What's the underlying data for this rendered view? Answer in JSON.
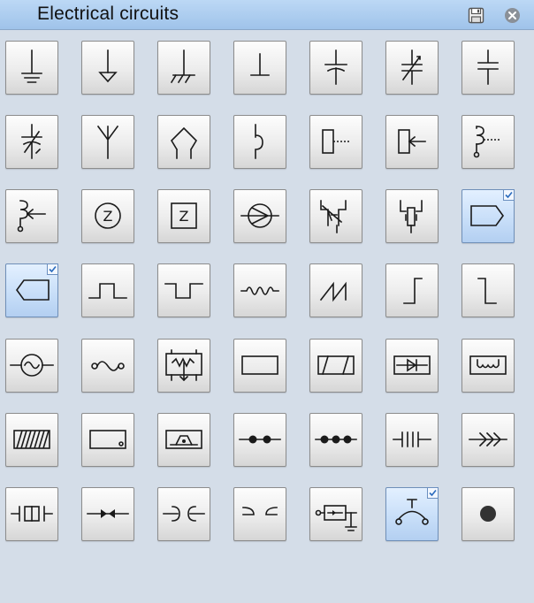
{
  "palette": {
    "title": "Electrical circuits"
  },
  "icons": {
    "save": "save-icon",
    "close": "close-icon",
    "checkmark": "checkmark-icon"
  },
  "colors": {
    "background": "#d4dde8",
    "titlebar": "#a9cbee",
    "selected_tile": "#c6ddf8",
    "symbol": "#1a1a1a"
  },
  "symbols": [
    {
      "name": "ground",
      "selected": false
    },
    {
      "name": "signal-ground",
      "selected": false
    },
    {
      "name": "chassis-ground",
      "selected": false
    },
    {
      "name": "earth-line",
      "selected": false
    },
    {
      "name": "capacitor",
      "selected": false
    },
    {
      "name": "variable-capacitor",
      "selected": false
    },
    {
      "name": "capacitor-vertical",
      "selected": false
    },
    {
      "name": "trimmer-capacitor",
      "selected": false
    },
    {
      "name": "antenna",
      "selected": false
    },
    {
      "name": "dipole-antenna",
      "selected": false
    },
    {
      "name": "jack",
      "selected": false
    },
    {
      "name": "relay-contact",
      "selected": false
    },
    {
      "name": "relay-input",
      "selected": false
    },
    {
      "name": "coil-dotted",
      "selected": false
    },
    {
      "name": "coil-arrow",
      "selected": false
    },
    {
      "name": "impedance-circle",
      "selected": false
    },
    {
      "name": "impedance-box",
      "selected": false
    },
    {
      "name": "current-source",
      "selected": false
    },
    {
      "name": "variable-resistor-switch",
      "selected": false
    },
    {
      "name": "resistor-contact",
      "selected": false
    },
    {
      "name": "output-terminal",
      "selected": true
    },
    {
      "name": "input-terminal",
      "selected": true
    },
    {
      "name": "pulse",
      "selected": false
    },
    {
      "name": "negative-pulse",
      "selected": false
    },
    {
      "name": "sine-wave",
      "selected": false
    },
    {
      "name": "sawtooth",
      "selected": false
    },
    {
      "name": "step-up",
      "selected": false
    },
    {
      "name": "step-down",
      "selected": false
    },
    {
      "name": "ac-source",
      "selected": false
    },
    {
      "name": "ac-wave-loops",
      "selected": false
    },
    {
      "name": "resistor-block",
      "selected": false
    },
    {
      "name": "rectangle-block",
      "selected": false
    },
    {
      "name": "hatched-block",
      "selected": false
    },
    {
      "name": "diode-block",
      "selected": false
    },
    {
      "name": "heater-block",
      "selected": false
    },
    {
      "name": "hatched-full-block",
      "selected": false
    },
    {
      "name": "block-with-dot",
      "selected": false
    },
    {
      "name": "shielded-block",
      "selected": false
    },
    {
      "name": "two-dots",
      "selected": false
    },
    {
      "name": "three-dots",
      "selected": false
    },
    {
      "name": "double-capacitor",
      "selected": false
    },
    {
      "name": "multi-arrow",
      "selected": false
    },
    {
      "name": "crystal",
      "selected": false
    },
    {
      "name": "opposing-arrows",
      "selected": false
    },
    {
      "name": "plug-and-socket",
      "selected": false
    },
    {
      "name": "socket-pair",
      "selected": false
    },
    {
      "name": "fuse-connector",
      "selected": false
    },
    {
      "name": "switch-arc",
      "selected": true
    },
    {
      "name": "solid-dot",
      "selected": false
    }
  ]
}
